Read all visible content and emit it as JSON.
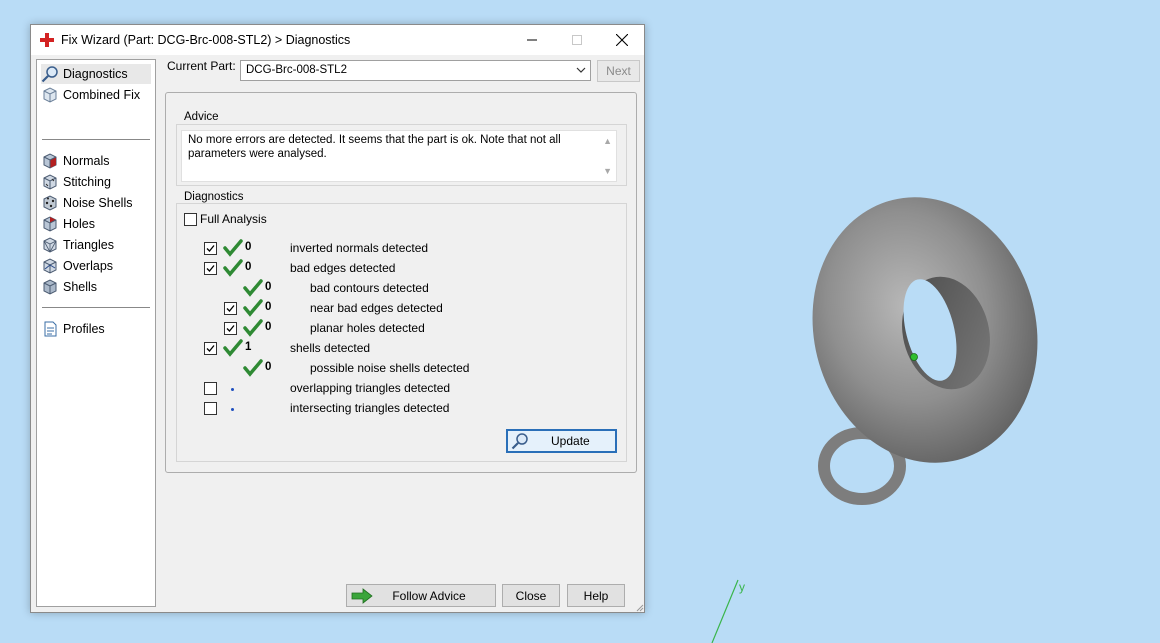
{
  "window": {
    "title": "Fix Wizard (Part: DCG-Brc-008-STL2) > Diagnostics"
  },
  "nav": {
    "items": [
      {
        "label": "Diagnostics",
        "icon": "diagnostics-icon"
      },
      {
        "label": "Combined Fix",
        "icon": "combined-fix-icon"
      },
      {
        "label": "Normals",
        "icon": "normals-icon"
      },
      {
        "label": "Stitching",
        "icon": "stitching-icon"
      },
      {
        "label": "Noise Shells",
        "icon": "noise-shells-icon"
      },
      {
        "label": "Holes",
        "icon": "holes-icon"
      },
      {
        "label": "Triangles",
        "icon": "triangles-icon"
      },
      {
        "label": "Overlaps",
        "icon": "overlaps-icon"
      },
      {
        "label": "Shells",
        "icon": "shells-icon"
      },
      {
        "label": "Profiles",
        "icon": "profiles-icon"
      }
    ],
    "selected": "Diagnostics"
  },
  "current_part": {
    "label": "Current Part:",
    "value": "DCG-Brc-008-STL2",
    "next_label": "Next"
  },
  "advice": {
    "group_label": "Advice",
    "text": "No more errors are detected. It seems that the part is ok. Note that not all parameters were analysed."
  },
  "diagnostics": {
    "group_label": "Diagnostics",
    "full_analysis_label": "Full Analysis",
    "rows": [
      {
        "checked": true,
        "status": "ok",
        "count": "0",
        "label": "inverted normals detected"
      },
      {
        "checked": true,
        "status": "ok",
        "count": "0",
        "label": "bad edges detected"
      },
      {
        "checked": null,
        "status": "ok",
        "count": "0",
        "label": "bad contours detected"
      },
      {
        "checked": true,
        "status": "ok",
        "count": "0",
        "label": "near bad edges detected"
      },
      {
        "checked": true,
        "status": "ok",
        "count": "0",
        "label": "planar holes detected"
      },
      {
        "checked": true,
        "status": "ok",
        "count": "1",
        "label": "shells detected"
      },
      {
        "checked": null,
        "status": "ok",
        "count": "0",
        "label": "possible noise shells detected"
      },
      {
        "checked": false,
        "status": "pending",
        "count": "",
        "label": "overlapping triangles detected"
      },
      {
        "checked": false,
        "status": "pending",
        "count": "",
        "label": "intersecting triangles detected"
      }
    ],
    "update_label": "Update"
  },
  "buttons": {
    "follow_advice": "Follow Advice",
    "close": "Close",
    "help": "Help"
  },
  "viewport": {
    "axis_label": "y"
  },
  "colors": {
    "viewport_bg": "#b9dcf6",
    "check_green": "#2f8a34",
    "dialog_bg": "#f0f0f0"
  }
}
